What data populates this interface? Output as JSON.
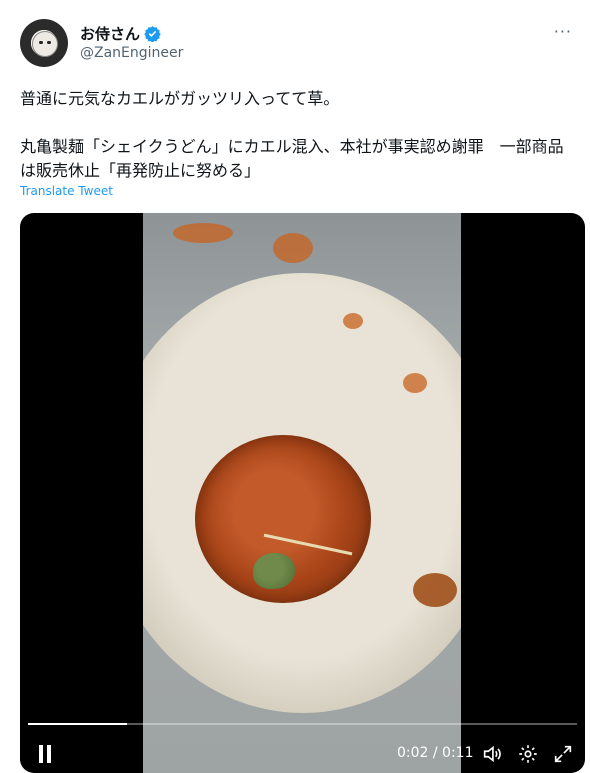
{
  "tweet": {
    "display_name": "お侍さん",
    "handle": "@ZanEngineer",
    "text": "普通に元気なカエルがガッツリ入ってて草。\n\n丸亀製麺「シェイクうどん」にカエル混入、本社が事実認め謝罪　一部商品は販売休止「再発防止に努める」",
    "translate_label": "Translate Tweet",
    "verified_color": "#1d9bf0"
  },
  "video": {
    "current_time": "0:02",
    "duration": "0:11",
    "time_display": "0:02 / 0:11",
    "progress_fraction": 0.18,
    "icons": [
      "pause-icon",
      "volume-icon",
      "settings-gear-icon",
      "fullscreen-icon"
    ]
  }
}
